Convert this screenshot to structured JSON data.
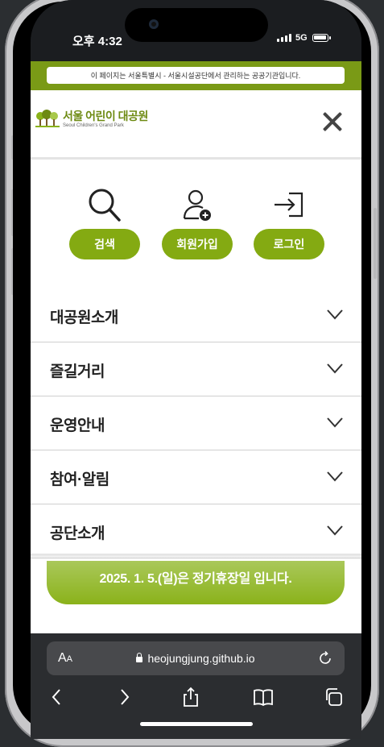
{
  "status": {
    "time": "오후 4:32",
    "network": "5G"
  },
  "notice": {
    "text": "이 페이지는 서울특별시 - 서울시설공단에서 관리하는 공공기관입니다."
  },
  "logo": {
    "name_ko": "서울 어린이 대공원",
    "name_en": "Seoul Children's Grand Park"
  },
  "quick_links": [
    {
      "label": "검색",
      "icon": "search-icon"
    },
    {
      "label": "회원가입",
      "icon": "add-user-icon"
    },
    {
      "label": "로그인",
      "icon": "login-icon"
    }
  ],
  "menu": [
    {
      "label": "대공원소개"
    },
    {
      "label": "즐길거리"
    },
    {
      "label": "운영안내"
    },
    {
      "label": "참여·알림"
    },
    {
      "label": "공단소개"
    }
  ],
  "banner": {
    "text": "2025. 1. 5.(일)은 정기휴장일 입니다."
  },
  "browser": {
    "aa_label": "AA",
    "url": "heojungjung.github.io"
  },
  "colors": {
    "brand_green": "#84aa12",
    "notice_green": "#7a9a16",
    "logo_green": "#6d8a12"
  }
}
